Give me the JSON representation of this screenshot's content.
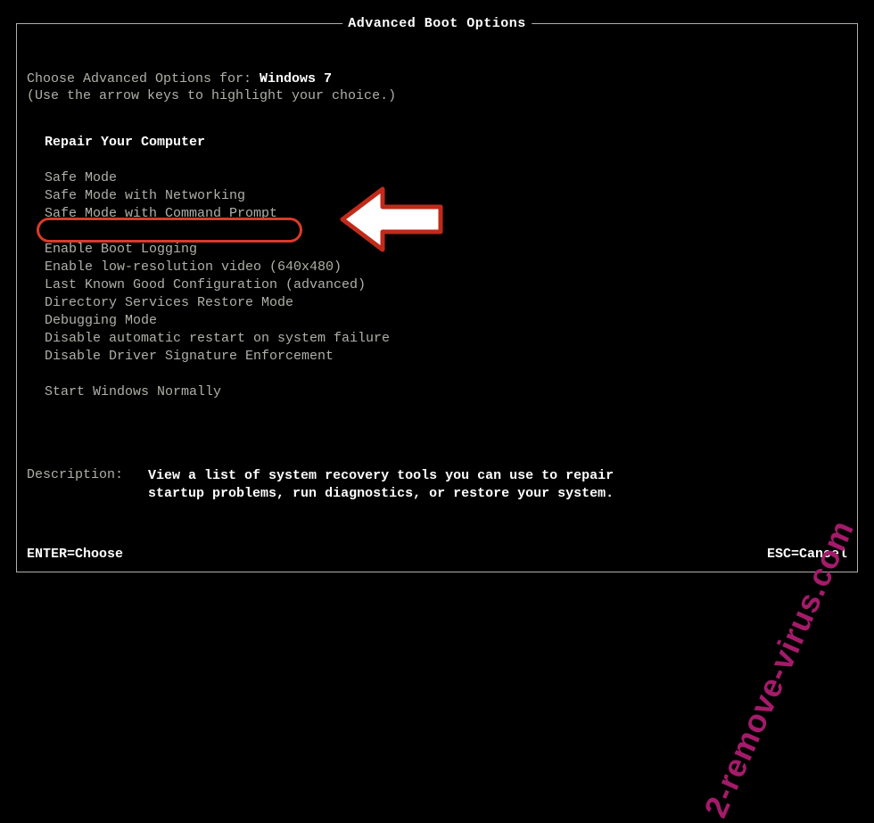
{
  "title": "Advanced Boot Options",
  "choose_prefix": "Choose Advanced Options for: ",
  "os_name": "Windows 7",
  "instruction": "(Use the arrow keys to highlight your choice.)",
  "options": {
    "repair": "Repair Your Computer",
    "safe_mode": "Safe Mode",
    "safe_mode_net": "Safe Mode with Networking",
    "safe_mode_cmd": "Safe Mode with Command Prompt",
    "boot_log": "Enable Boot Logging",
    "low_res": "Enable low-resolution video (640x480)",
    "last_known": "Last Known Good Configuration (advanced)",
    "ds_restore": "Directory Services Restore Mode",
    "debug": "Debugging Mode",
    "no_restart": "Disable automatic restart on system failure",
    "no_driver_sig": "Disable Driver Signature Enforcement",
    "start_normal": "Start Windows Normally"
  },
  "description": {
    "label": "Description:",
    "text": "View a list of system recovery tools you can use to repair startup problems, run diagnostics, or restore your system."
  },
  "footer": {
    "enter": "ENTER=Choose",
    "esc": "ESC=Cancel"
  },
  "watermark": "2-remove-virus.com"
}
